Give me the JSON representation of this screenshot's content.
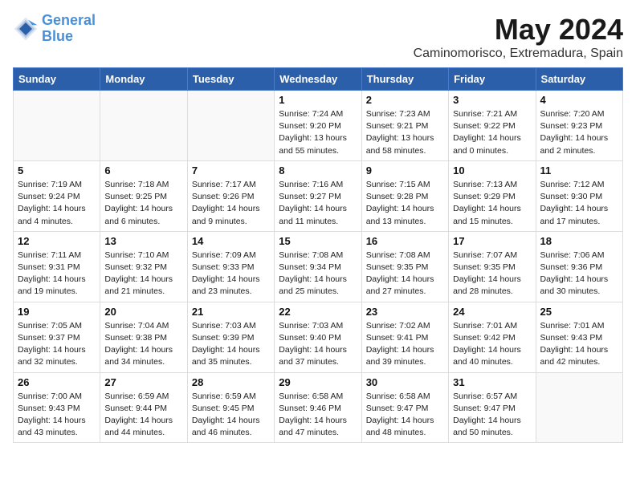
{
  "logo": {
    "line1": "General",
    "line2": "Blue"
  },
  "title": "May 2024",
  "location": "Caminomorisco, Extremadura, Spain",
  "weekdays": [
    "Sunday",
    "Monday",
    "Tuesday",
    "Wednesday",
    "Thursday",
    "Friday",
    "Saturday"
  ],
  "weeks": [
    [
      {
        "day": "",
        "info": ""
      },
      {
        "day": "",
        "info": ""
      },
      {
        "day": "",
        "info": ""
      },
      {
        "day": "1",
        "info": "Sunrise: 7:24 AM\nSunset: 9:20 PM\nDaylight: 13 hours\nand 55 minutes."
      },
      {
        "day": "2",
        "info": "Sunrise: 7:23 AM\nSunset: 9:21 PM\nDaylight: 13 hours\nand 58 minutes."
      },
      {
        "day": "3",
        "info": "Sunrise: 7:21 AM\nSunset: 9:22 PM\nDaylight: 14 hours\nand 0 minutes."
      },
      {
        "day": "4",
        "info": "Sunrise: 7:20 AM\nSunset: 9:23 PM\nDaylight: 14 hours\nand 2 minutes."
      }
    ],
    [
      {
        "day": "5",
        "info": "Sunrise: 7:19 AM\nSunset: 9:24 PM\nDaylight: 14 hours\nand 4 minutes."
      },
      {
        "day": "6",
        "info": "Sunrise: 7:18 AM\nSunset: 9:25 PM\nDaylight: 14 hours\nand 6 minutes."
      },
      {
        "day": "7",
        "info": "Sunrise: 7:17 AM\nSunset: 9:26 PM\nDaylight: 14 hours\nand 9 minutes."
      },
      {
        "day": "8",
        "info": "Sunrise: 7:16 AM\nSunset: 9:27 PM\nDaylight: 14 hours\nand 11 minutes."
      },
      {
        "day": "9",
        "info": "Sunrise: 7:15 AM\nSunset: 9:28 PM\nDaylight: 14 hours\nand 13 minutes."
      },
      {
        "day": "10",
        "info": "Sunrise: 7:13 AM\nSunset: 9:29 PM\nDaylight: 14 hours\nand 15 minutes."
      },
      {
        "day": "11",
        "info": "Sunrise: 7:12 AM\nSunset: 9:30 PM\nDaylight: 14 hours\nand 17 minutes."
      }
    ],
    [
      {
        "day": "12",
        "info": "Sunrise: 7:11 AM\nSunset: 9:31 PM\nDaylight: 14 hours\nand 19 minutes."
      },
      {
        "day": "13",
        "info": "Sunrise: 7:10 AM\nSunset: 9:32 PM\nDaylight: 14 hours\nand 21 minutes."
      },
      {
        "day": "14",
        "info": "Sunrise: 7:09 AM\nSunset: 9:33 PM\nDaylight: 14 hours\nand 23 minutes."
      },
      {
        "day": "15",
        "info": "Sunrise: 7:08 AM\nSunset: 9:34 PM\nDaylight: 14 hours\nand 25 minutes."
      },
      {
        "day": "16",
        "info": "Sunrise: 7:08 AM\nSunset: 9:35 PM\nDaylight: 14 hours\nand 27 minutes."
      },
      {
        "day": "17",
        "info": "Sunrise: 7:07 AM\nSunset: 9:35 PM\nDaylight: 14 hours\nand 28 minutes."
      },
      {
        "day": "18",
        "info": "Sunrise: 7:06 AM\nSunset: 9:36 PM\nDaylight: 14 hours\nand 30 minutes."
      }
    ],
    [
      {
        "day": "19",
        "info": "Sunrise: 7:05 AM\nSunset: 9:37 PM\nDaylight: 14 hours\nand 32 minutes."
      },
      {
        "day": "20",
        "info": "Sunrise: 7:04 AM\nSunset: 9:38 PM\nDaylight: 14 hours\nand 34 minutes."
      },
      {
        "day": "21",
        "info": "Sunrise: 7:03 AM\nSunset: 9:39 PM\nDaylight: 14 hours\nand 35 minutes."
      },
      {
        "day": "22",
        "info": "Sunrise: 7:03 AM\nSunset: 9:40 PM\nDaylight: 14 hours\nand 37 minutes."
      },
      {
        "day": "23",
        "info": "Sunrise: 7:02 AM\nSunset: 9:41 PM\nDaylight: 14 hours\nand 39 minutes."
      },
      {
        "day": "24",
        "info": "Sunrise: 7:01 AM\nSunset: 9:42 PM\nDaylight: 14 hours\nand 40 minutes."
      },
      {
        "day": "25",
        "info": "Sunrise: 7:01 AM\nSunset: 9:43 PM\nDaylight: 14 hours\nand 42 minutes."
      }
    ],
    [
      {
        "day": "26",
        "info": "Sunrise: 7:00 AM\nSunset: 9:43 PM\nDaylight: 14 hours\nand 43 minutes."
      },
      {
        "day": "27",
        "info": "Sunrise: 6:59 AM\nSunset: 9:44 PM\nDaylight: 14 hours\nand 44 minutes."
      },
      {
        "day": "28",
        "info": "Sunrise: 6:59 AM\nSunset: 9:45 PM\nDaylight: 14 hours\nand 46 minutes."
      },
      {
        "day": "29",
        "info": "Sunrise: 6:58 AM\nSunset: 9:46 PM\nDaylight: 14 hours\nand 47 minutes."
      },
      {
        "day": "30",
        "info": "Sunrise: 6:58 AM\nSunset: 9:47 PM\nDaylight: 14 hours\nand 48 minutes."
      },
      {
        "day": "31",
        "info": "Sunrise: 6:57 AM\nSunset: 9:47 PM\nDaylight: 14 hours\nand 50 minutes."
      },
      {
        "day": "",
        "info": ""
      }
    ]
  ]
}
